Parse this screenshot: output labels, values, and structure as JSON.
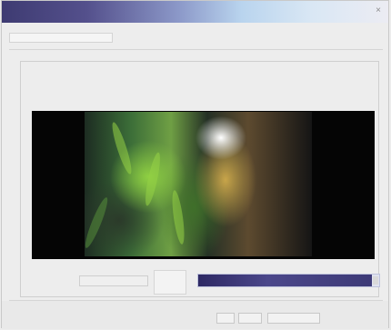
{
  "window": {
    "title": "",
    "close_glyph": "×"
  },
  "menu": {
    "label": ""
  },
  "group": {
    "label": "",
    "sub_label_1": "",
    "sub_label_2": ""
  },
  "controls": {
    "left_button_label": "",
    "progress_percent": 0.96
  },
  "footer": {
    "buttons": [
      {
        "label": ""
      },
      {
        "label": ""
      },
      {
        "label": ""
      }
    ]
  },
  "colors": {
    "titlebar_start": "#3e3b72",
    "titlebar_end": "#ececf3",
    "progress_fill": "#3d3a77"
  },
  "icons": {
    "close": "close-icon"
  }
}
